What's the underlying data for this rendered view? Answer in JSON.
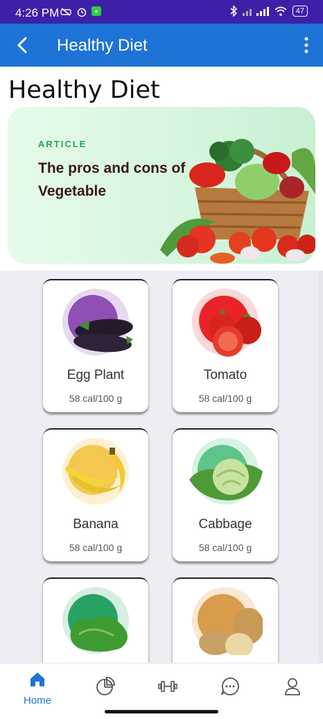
{
  "status": {
    "time": "4:26 PM",
    "battery": "47"
  },
  "app_bar": {
    "title": "Healthy Diet"
  },
  "page": {
    "heading": "Healthy Diet"
  },
  "banner": {
    "tag": "ARTICLE",
    "title": "The pros and cons of Vegetable"
  },
  "foods": [
    {
      "name": "Egg Plant",
      "cal": "58 cal/100 g",
      "bg": "#e6d9f1",
      "circle": "#8f4fb5",
      "icon": "eggplant-icon"
    },
    {
      "name": "Tomato",
      "cal": "58 cal/100 g",
      "bg": "#fbd8d8",
      "circle": "#e8242a",
      "icon": "tomato-icon"
    },
    {
      "name": "Banana",
      "cal": "58 cal/100 g",
      "bg": "#fdf1d2",
      "circle": "#f4c74f",
      "icon": "banana-icon"
    },
    {
      "name": "Cabbage",
      "cal": "58 cal/100 g",
      "bg": "#d7f3e1",
      "circle": "#5cc589",
      "icon": "cabbage-icon"
    },
    {
      "name": "",
      "cal": "",
      "bg": "#d6efe1",
      "circle": "#27a263",
      "icon": "lettuce-icon"
    },
    {
      "name": "",
      "cal": "",
      "bg": "#f8e8d4",
      "circle": "#d99b4c",
      "icon": "potato-icon"
    }
  ],
  "nav": {
    "items": [
      {
        "label": "Home",
        "icon": "home-icon",
        "active": true
      },
      {
        "label": "",
        "icon": "pie-chart-icon"
      },
      {
        "label": "",
        "icon": "dumbbell-icon"
      },
      {
        "label": "",
        "icon": "chat-icon"
      },
      {
        "label": "",
        "icon": "profile-icon"
      }
    ]
  },
  "colors": {
    "status_bar": "#3d1fa8",
    "app_bar": "#1e73d6",
    "accent": "#1e73d6"
  }
}
